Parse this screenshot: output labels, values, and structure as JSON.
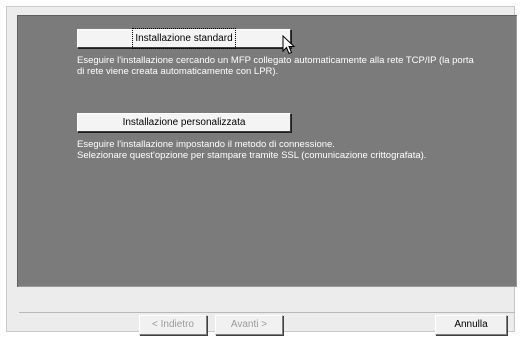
{
  "options": [
    {
      "button_label": "Installazione standard",
      "description_lines": [
        "Eseguire l'installazione cercando un MFP collegato automaticamente alla rete TCP/IP (la porta",
        "di rete viene creata automaticamente con LPR)."
      ]
    },
    {
      "button_label": "Installazione personalizzata",
      "description_lines": [
        "Eseguire l'installazione impostando il metodo di connessione.",
        "Selezionare quest'opzione per stampare tramite SSL (comunicazione crittografata)."
      ]
    }
  ],
  "footer": {
    "back_label": "< Indietro",
    "next_label": "Avanti >",
    "cancel_label": "Annulla"
  },
  "icons": {
    "pointer": "mouse-pointer-icon"
  },
  "colors": {
    "panel_background": "#7b7b7b",
    "description_text": "#ffffff",
    "disabled_text": "#9a9a9a"
  }
}
